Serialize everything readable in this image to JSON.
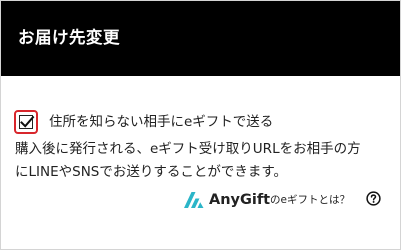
{
  "header": {
    "title": "お届け先変更"
  },
  "gift_option": {
    "checked": true,
    "label": "住所を知らない相手にeギフトで送る"
  },
  "description": {
    "line1": "購入後に発行される、eギフト受け取りURLをお相手の方",
    "line2": "にLINEやSNSでお送りすることができます。"
  },
  "footer": {
    "brand_name": "AnyGift",
    "info_link": "のeギフトとは？",
    "brand_icon": "anygift-logo",
    "help_icon": "question-circle-icon"
  },
  "colors": {
    "header_bg": "#000000",
    "header_text": "#ffffff",
    "checkbox_outline": "#d8262c",
    "brand_accent": "#2bb5c8",
    "text": "#222222"
  }
}
